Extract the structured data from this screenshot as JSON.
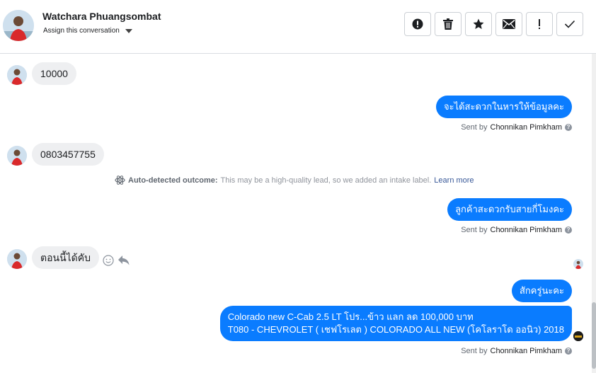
{
  "header": {
    "name": "Watchara Phuangsombat",
    "assign_label": "Assign this conversation"
  },
  "actions": [
    {
      "name": "report-icon",
      "glyph": "!"
    },
    {
      "name": "trash-icon"
    },
    {
      "name": "star-icon"
    },
    {
      "name": "mail-icon"
    },
    {
      "name": "important-icon",
      "glyph": "!"
    },
    {
      "name": "check-icon"
    }
  ],
  "messages": [
    {
      "side": "in",
      "text": "10000"
    },
    {
      "side": "out",
      "text": "จะได้สะดวกในหารให้ข้อมูลคะ",
      "sent_by_prefix": "Sent by",
      "sender": "Chonnikan Pimkham"
    },
    {
      "side": "in",
      "text": "0803457755"
    },
    {
      "side": "out",
      "text": "ลูกค้าสะดวกรับสายกี่โมงคะ",
      "sent_by_prefix": "Sent by",
      "sender": "Chonnikan Pimkham"
    },
    {
      "side": "in",
      "text": "ตอนนี้ได้คับ"
    },
    {
      "side": "out",
      "text": "สักครู่นะคะ"
    },
    {
      "side": "out",
      "line1": "Colorado new C-Cab 2.5 LT โปร...ข้าว แลก ลด 100,000 บาท",
      "line2": "T080 - CHEVROLET ( เชฟโรเลต ) COLORADO ALL NEW (โคโลราโด ออนิว) 2018",
      "sent_by_prefix": "Sent by",
      "sender": "Chonnikan Pimkham"
    }
  ],
  "outcome": {
    "title": "Auto-detected outcome:",
    "text": "This may be a high-quality lead, so we added an intake label.",
    "link": "Learn more"
  },
  "colors": {
    "outgoing_bubble": "#0a7cff",
    "incoming_bubble": "#eeeff1",
    "link": "#385898"
  }
}
